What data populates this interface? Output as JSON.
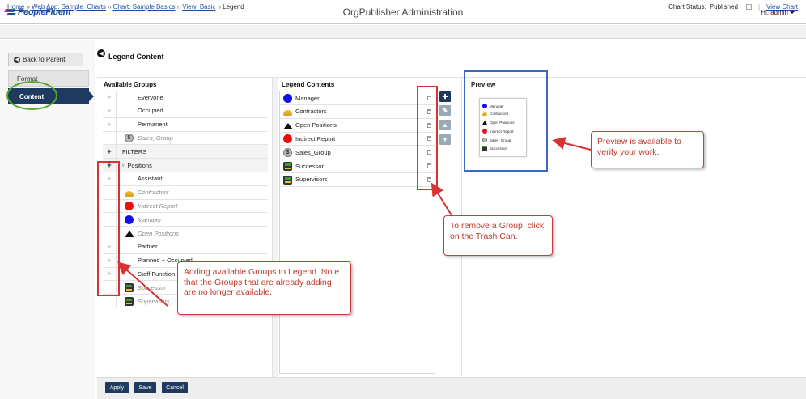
{
  "header": {
    "logo_text": "PeopleFluent",
    "app_title": "OrgPublisher Administration",
    "user_greeting": "Hi,  admin"
  },
  "breadcrumb": {
    "items": [
      "Home",
      "Web App: Sample_Charts",
      "Chart: Sample Basics",
      "View: Basic"
    ],
    "current": "Legend",
    "separator": "››"
  },
  "chart_status": {
    "label": "Chart Status:",
    "value": "Published",
    "view_chart": "View Chart"
  },
  "left_nav": {
    "back_label": "Back to Parent",
    "tabs": [
      {
        "label": "Format",
        "active": false
      },
      {
        "label": "Content",
        "active": true
      }
    ]
  },
  "page": {
    "title": "Legend Content"
  },
  "available_groups": {
    "heading": "Available Groups",
    "rows": [
      {
        "label": "Everyone",
        "plus": "+",
        "type": "item"
      },
      {
        "label": "Occupied",
        "plus": "+",
        "type": "item"
      },
      {
        "label": "Permanent",
        "plus": "+",
        "type": "item"
      },
      {
        "label": "Sales_Group",
        "plus": "",
        "type": "disabled",
        "icon": "dollar-icon"
      },
      {
        "label": "FILTERS",
        "plus": "+",
        "type": "group"
      },
      {
        "label": "Positions",
        "plus": "+",
        "type": "group",
        "expander": "∨"
      },
      {
        "label": "Assistant",
        "plus": "+",
        "type": "item"
      },
      {
        "label": "Contractors",
        "plus": "",
        "type": "disabled",
        "icon": "hardhat-icon"
      },
      {
        "label": "Indirect Report",
        "plus": "",
        "type": "disabled",
        "icon": "red-dot-icon"
      },
      {
        "label": "Manager",
        "plus": "",
        "type": "disabled",
        "icon": "blue-dot-icon"
      },
      {
        "label": "Open Positions",
        "plus": "",
        "type": "disabled",
        "icon": "triangle-icon"
      },
      {
        "label": "Partner",
        "plus": "+",
        "type": "item"
      },
      {
        "label": "Planned + Occupied",
        "plus": "+",
        "type": "item"
      },
      {
        "label": "Staff Function",
        "plus": "+",
        "type": "item"
      },
      {
        "label": "Successor",
        "plus": "",
        "type": "disabled",
        "icon": "person-icon"
      },
      {
        "label": "Supervisors",
        "plus": "",
        "type": "disabled",
        "icon": "person-icon"
      }
    ]
  },
  "legend_contents": {
    "heading": "Legend Contents",
    "rows": [
      {
        "label": "Manager",
        "icon": "blue-dot-icon"
      },
      {
        "label": "Contractors",
        "icon": "hardhat-icon"
      },
      {
        "label": "Open Positions",
        "icon": "triangle-icon"
      },
      {
        "label": "Indirect Report",
        "icon": "red-dot-icon"
      },
      {
        "label": "Sales_Group",
        "icon": "dollar-icon"
      },
      {
        "label": "Successor",
        "icon": "person-icon"
      },
      {
        "label": "Supervisors",
        "icon": "person-icon"
      }
    ]
  },
  "preview": {
    "heading": "Preview",
    "items": [
      "Manager",
      "Contractors",
      "Open Positions",
      "Indirect Report",
      "Sales_Group",
      "Successor"
    ]
  },
  "callouts": {
    "preview": "Preview is available to verify your work.",
    "remove": "To remove a Group, click on the Trash Can.",
    "adding": "Adding available Groups to Legend. Note that the Groups that are already adding are no longer available."
  },
  "buttons": {
    "apply": "Apply",
    "save": "Save",
    "cancel": "Cancel"
  },
  "colors": {
    "accent_navy": "#1e3a5f",
    "link_blue": "#1a4e9b",
    "callout_red": "#d83232",
    "preview_box_blue": "#3a68c6",
    "highlight_green": "#5aa832"
  }
}
